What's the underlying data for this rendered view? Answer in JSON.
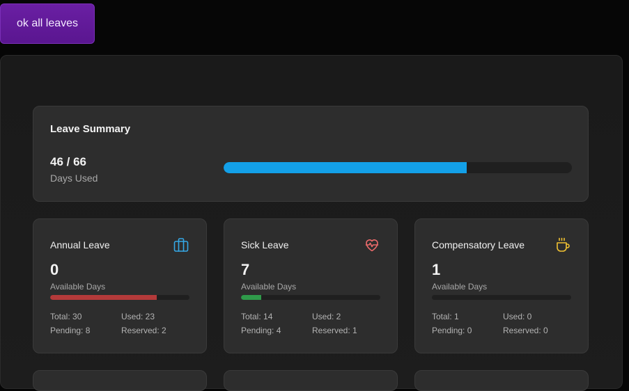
{
  "top_button": {
    "label": "ok all leaves"
  },
  "summary": {
    "title": "Leave Summary",
    "count": "46 / 66",
    "subtitle": "Days Used",
    "progress": 0.697
  },
  "cards": [
    {
      "title": "Annual Leave",
      "icon": "briefcase-icon",
      "icon_color": "#35a8e6",
      "value": "0",
      "available_label": "Available Days",
      "progress": 0.767,
      "bar_color": "#b43a3a",
      "total": "Total: 30",
      "used": "Used: 23",
      "pending": "Pending: 8",
      "reserved": "Reserved: 2"
    },
    {
      "title": "Sick Leave",
      "icon": "heart-pulse-icon",
      "icon_color": "#ec6b6b",
      "value": "7",
      "available_label": "Available Days",
      "progress": 0.143,
      "bar_color": "#2f9a4a",
      "total": "Total: 14",
      "used": "Used: 2",
      "pending": "Pending: 4",
      "reserved": "Reserved: 1"
    },
    {
      "title": "Compensatory Leave",
      "icon": "coffee-cup-icon",
      "icon_color": "#f1c232",
      "value": "1",
      "available_label": "Available Days",
      "progress": 0,
      "bar_color": "#2f9a4a",
      "total": "Total: 1",
      "used": "Used: 0",
      "pending": "Pending: 0",
      "reserved": "Reserved: 0"
    }
  ],
  "colors": {
    "accent_button": "#6a1fa3",
    "summary_bar": "#13a0e8",
    "card_background": "#2d2d2d"
  }
}
